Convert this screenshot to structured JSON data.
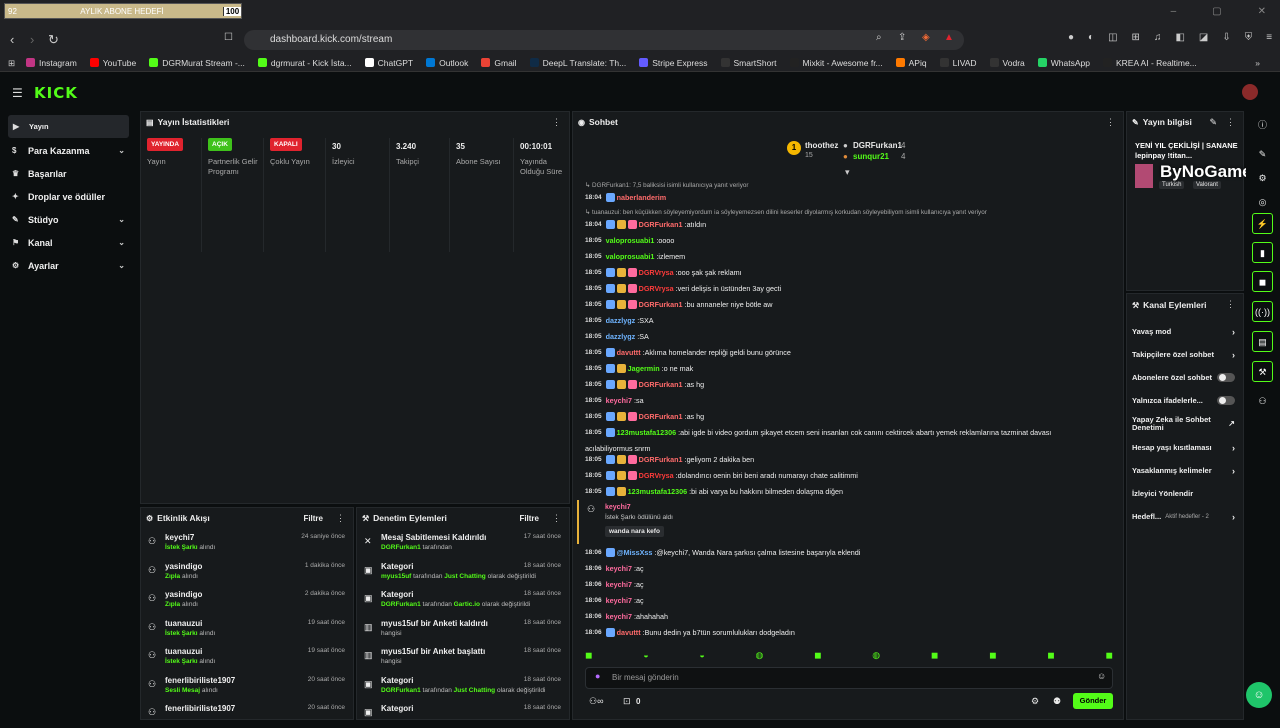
{
  "browser": {
    "goal": {
      "left": "92",
      "title": "AYLIK ABONE HEDEFİ",
      "right": "100"
    },
    "url": "dashboard.kick.com/stream",
    "bookmarks": [
      "Instagram",
      "YouTube",
      "DGRMurat Stream -...",
      "dgrmurat - Kick İsta...",
      "ChatGPT",
      "Outlook",
      "Gmail",
      "DeepL Translate: Th...",
      "Stripe Express",
      "SmartShort",
      "Mixkit - Awesome fr...",
      "APiq",
      "LIVAD",
      "Vodra",
      "WhatsApp",
      "KREA AI - Realtime..."
    ]
  },
  "brand": {
    "logo": "KICK"
  },
  "sidebar": [
    {
      "label": "Yayın",
      "icon": "video-icon",
      "active": true,
      "chev": false
    },
    {
      "label": "Para Kazanma",
      "icon": "dollar-icon",
      "active": false,
      "chev": true
    },
    {
      "label": "Başarılar",
      "icon": "trophy-icon",
      "active": false,
      "chev": false
    },
    {
      "label": "Droplar ve ödüller",
      "icon": "gift-icon",
      "active": false,
      "chev": false
    },
    {
      "label": "Stüdyo",
      "icon": "studio-icon",
      "active": false,
      "chev": true
    },
    {
      "label": "Kanal",
      "icon": "channel-icon",
      "active": false,
      "chev": true
    },
    {
      "label": "Ayarlar",
      "icon": "gear-icon",
      "active": false,
      "chev": true
    }
  ],
  "stats": {
    "title": "Yayın İstatistikleri",
    "cols": [
      {
        "badge": "YAYINDA",
        "badgeColor": "#e0232e",
        "label": "Yayın"
      },
      {
        "badge": "AÇIK",
        "badgeColor": "#3fc21b",
        "label": "Partnerlik Gelir Programı"
      },
      {
        "badge": "KAPALI",
        "badgeColor": "#e0232e",
        "label": "Çoklu Yayın"
      },
      {
        "value": "30",
        "label": "İzleyici"
      },
      {
        "value": "3.240",
        "label": "Takipçi"
      },
      {
        "value": "35",
        "label": "Abone Sayısı"
      },
      {
        "value": "00:10:01",
        "label": "Yayında Olduğu Süre"
      }
    ]
  },
  "activity": {
    "title": "Etkinlik Akışı",
    "filter": "Filtre",
    "items": [
      {
        "name": "keychi7",
        "hl": "İstek Şarkı",
        "rest": " alındı",
        "time": "24 saniye önce"
      },
      {
        "name": "yasindigo",
        "hl": "Zıpla",
        "rest": " alındı",
        "time": "1 dakika önce"
      },
      {
        "name": "yasindigo",
        "hl": "Zıpla",
        "rest": " alındı",
        "time": "2 dakika önce"
      },
      {
        "name": "tuanauzui",
        "hl": "İstek Şarkı",
        "rest": " alındı",
        "time": "19 saat önce"
      },
      {
        "name": "tuanauzui",
        "hl": "İstek Şarkı",
        "rest": " alındı",
        "time": "19 saat önce"
      },
      {
        "name": "fenerlibiriliste1907",
        "hl": "Sesli Mesaj",
        "rest": " alındı",
        "time": "20 saat önce"
      },
      {
        "name": "fenerlibiriliste1907",
        "hl": "",
        "rest": "",
        "time": "20 saat önce"
      }
    ]
  },
  "mod": {
    "title": "Denetim Eylemleri",
    "filter": "Filtre",
    "items": [
      {
        "name": "Mesaj Sabitlemesi Kaldırıldı",
        "sub": [
          [
            "DGRFurkan1",
            true
          ],
          [
            " tarafından",
            false
          ]
        ],
        "time": "17 saat önce",
        "icon": "unpin-icon"
      },
      {
        "name": "Kategori",
        "sub": [
          [
            "myus15uf",
            true
          ],
          [
            " tarafından ",
            false
          ],
          [
            "Just Chatting",
            true
          ],
          [
            " olarak değiştirildi",
            false
          ]
        ],
        "time": "18 saat önce",
        "icon": "category-icon"
      },
      {
        "name": "Kategori",
        "sub": [
          [
            "DGRFurkan1",
            true
          ],
          [
            " tarafından ",
            false
          ],
          [
            "Gartic.io",
            true
          ],
          [
            " olarak değiştirildi",
            false
          ]
        ],
        "time": "18 saat önce",
        "icon": "category-icon"
      },
      {
        "name": "myus15uf bir Anketi kaldırdı",
        "sub": [
          [
            "hangisi",
            false
          ]
        ],
        "time": "18 saat önce",
        "icon": "poll-icon"
      },
      {
        "name": "myus15uf bir Anket başlattı",
        "sub": [
          [
            "hangisi",
            false
          ]
        ],
        "time": "18 saat önce",
        "icon": "poll-icon"
      },
      {
        "name": "Kategori",
        "sub": [
          [
            "DGRFurkan1",
            true
          ],
          [
            " tarafından ",
            false
          ],
          [
            "Just Chatting",
            true
          ],
          [
            " olarak değiştirildi",
            false
          ]
        ],
        "time": "18 saat önce",
        "icon": "category-icon"
      },
      {
        "name": "Kategori",
        "sub": [],
        "time": "18 saat önce",
        "icon": "category-icon"
      }
    ]
  },
  "chat": {
    "title": "Sohbet",
    "leaders": [
      {
        "name": "thoothez",
        "n": "15"
      },
      {
        "name": "DGRFurkan1",
        "n": "4"
      },
      {
        "name": "sunqur21",
        "n": "4"
      }
    ],
    "messages": [
      {
        "t": "",
        "u": "",
        "c": "",
        "m": "↳ DGRFurkan1: 7,5 baliksisi isimli kullanıcıya yanıt veriyor",
        "sys": true
      },
      {
        "t": "18:04",
        "u": "naberlanderim",
        "c": "#ff6b6b",
        "m": "",
        "b": 1
      },
      {
        "t": "",
        "u": "",
        "c": "",
        "m": "↳ tuanauzui: ben küçükken söyleyemiyordum ia söyleyemezsen dilini keserler diyolarmış korkudan söyleyebiliyom isimli kullanıcıya yanıt veriyor",
        "sys": true
      },
      {
        "t": "18:04",
        "u": "DGRFurkan1",
        "c": "#ff6b6b",
        "m": "atıldın",
        "b": 3
      },
      {
        "t": "18:05",
        "u": "valoprosuabi1",
        "c": "#53fc18",
        "m": "oooo",
        "b": 0
      },
      {
        "t": "18:05",
        "u": "valoprosuabi1",
        "c": "#53fc18",
        "m": "izlemem",
        "b": 0
      },
      {
        "t": "18:05",
        "u": "DGRVrysa",
        "c": "#ff3b3b",
        "m": "ooo şak şak reklamı",
        "b": 3
      },
      {
        "t": "18:05",
        "u": "DGRVrysa",
        "c": "#ff3b3b",
        "m": "veri delişis in üstünden 3ay gecti",
        "b": 3
      },
      {
        "t": "18:05",
        "u": "DGRFurkan1",
        "c": "#ff6b6b",
        "m": "bu annaneler niye bötle aw",
        "b": 3
      },
      {
        "t": "18:05",
        "u": "dazzlygz",
        "c": "#6fb4ff",
        "m": "SXA",
        "b": 0
      },
      {
        "t": "18:05",
        "u": "dazzlygz",
        "c": "#6fb4ff",
        "m": "SA",
        "b": 0
      },
      {
        "t": "18:05",
        "u": "davuttt",
        "c": "#ff6b6b",
        "m": "Aklıma homelander repliği geldi bunu görünce",
        "b": 1
      },
      {
        "t": "18:05",
        "u": "Jagermin",
        "c": "#53fc18",
        "m": "o ne mak",
        "b": 2
      },
      {
        "t": "18:05",
        "u": "DGRFurkan1",
        "c": "#ff6b6b",
        "m": "as hg",
        "b": 3
      },
      {
        "t": "18:05",
        "u": "keychi7",
        "c": "#ff6b9e",
        "m": "sa",
        "b": 0
      },
      {
        "t": "18:05",
        "u": "DGRFurkan1",
        "c": "#ff6b6b",
        "m": "as hg",
        "b": 3
      },
      {
        "t": "18:05",
        "u": "123mustafa12306",
        "c": "#53fc18",
        "m": "abi igde bi video gordum şikayet etcem seni insanları cok canını cektircek abartı yemek reklamlarına tazminat davası",
        "b": 1
      },
      {
        "t": "",
        "u": "",
        "c": "",
        "m": "acılabiliyormus snrm",
        "cont": true
      },
      {
        "t": "18:05",
        "u": "DGRFurkan1",
        "c": "#ff6b6b",
        "m": "geliyom 2 dakika ben",
        "b": 3
      },
      {
        "t": "18:05",
        "u": "DGRVrysa",
        "c": "#ff3b3b",
        "m": "dolandırıcı oenin biri beni aradı numarayı chate salitimmi",
        "b": 3
      },
      {
        "t": "18:05",
        "u": "123mustafa12306",
        "c": "#53fc18",
        "m": "bi abi varya bu hakkını bilmeden dolaşma diğen",
        "b": 2
      }
    ],
    "redeem": {
      "user": "keychi7",
      "desc": "İstek Şarkı ödülünü aldı",
      "song": "wanda nara kefo"
    },
    "messages2": [
      {
        "t": "18:06",
        "u": "@MissXss",
        "c": "#6fb4ff",
        "m": "@keychi7, Wanda Nara şarkısı çalma listesine başarıyla eklendi",
        "b": 1
      },
      {
        "t": "18:06",
        "u": "keychi7",
        "c": "#ff6b9e",
        "m": "aç",
        "b": 0
      },
      {
        "t": "18:06",
        "u": "keychi7",
        "c": "#ff6b9e",
        "m": "aç",
        "b": 0
      },
      {
        "t": "18:06",
        "u": "keychi7",
        "c": "#ff6b9e",
        "m": "aç",
        "b": 0
      },
      {
        "t": "18:06",
        "u": "keychi7",
        "c": "#ff6b9e",
        "m": "ahahahah",
        "b": 0
      },
      {
        "t": "18:06",
        "u": "davuttt",
        "c": "#ff6b6b",
        "m": "Bunu dedin ya b7tün sorumlulukları dodgeladın",
        "b": 1
      }
    ],
    "input_placeholder": "Bir mesaj gönderin",
    "count": "0",
    "send": "Gönder"
  },
  "info": {
    "title": "Yayın bilgisi",
    "stream_title": "YENİ YIL ÇEKİLİŞİ | SANANE lepinpay !titan...",
    "tags": [
      "Turkish",
      "Valorant"
    ],
    "watermark": "ByNoGame"
  },
  "actions": {
    "title": "Kanal Eylemleri",
    "items": [
      {
        "label": "Yavaş mod",
        "type": "chev"
      },
      {
        "label": "Takipçilere özel sohbet",
        "type": "chev"
      },
      {
        "label": "Abonelere özel sohbet",
        "type": "toggle"
      },
      {
        "label": "Yalnızca ifadelerle...",
        "type": "toggle"
      },
      {
        "label": "Yapay Zeka ile Sohbet Denetimi",
        "type": "ext"
      },
      {
        "label": "Hesap yaşı kısıtlaması",
        "type": "chev"
      },
      {
        "label": "Yasaklanmış kelimeler",
        "type": "chev"
      },
      {
        "label": "İzleyici Yönlendir",
        "type": "none"
      },
      {
        "label": "Hedefl...",
        "type": "goal",
        "extra": "Aktif hedefler - 2"
      }
    ]
  }
}
